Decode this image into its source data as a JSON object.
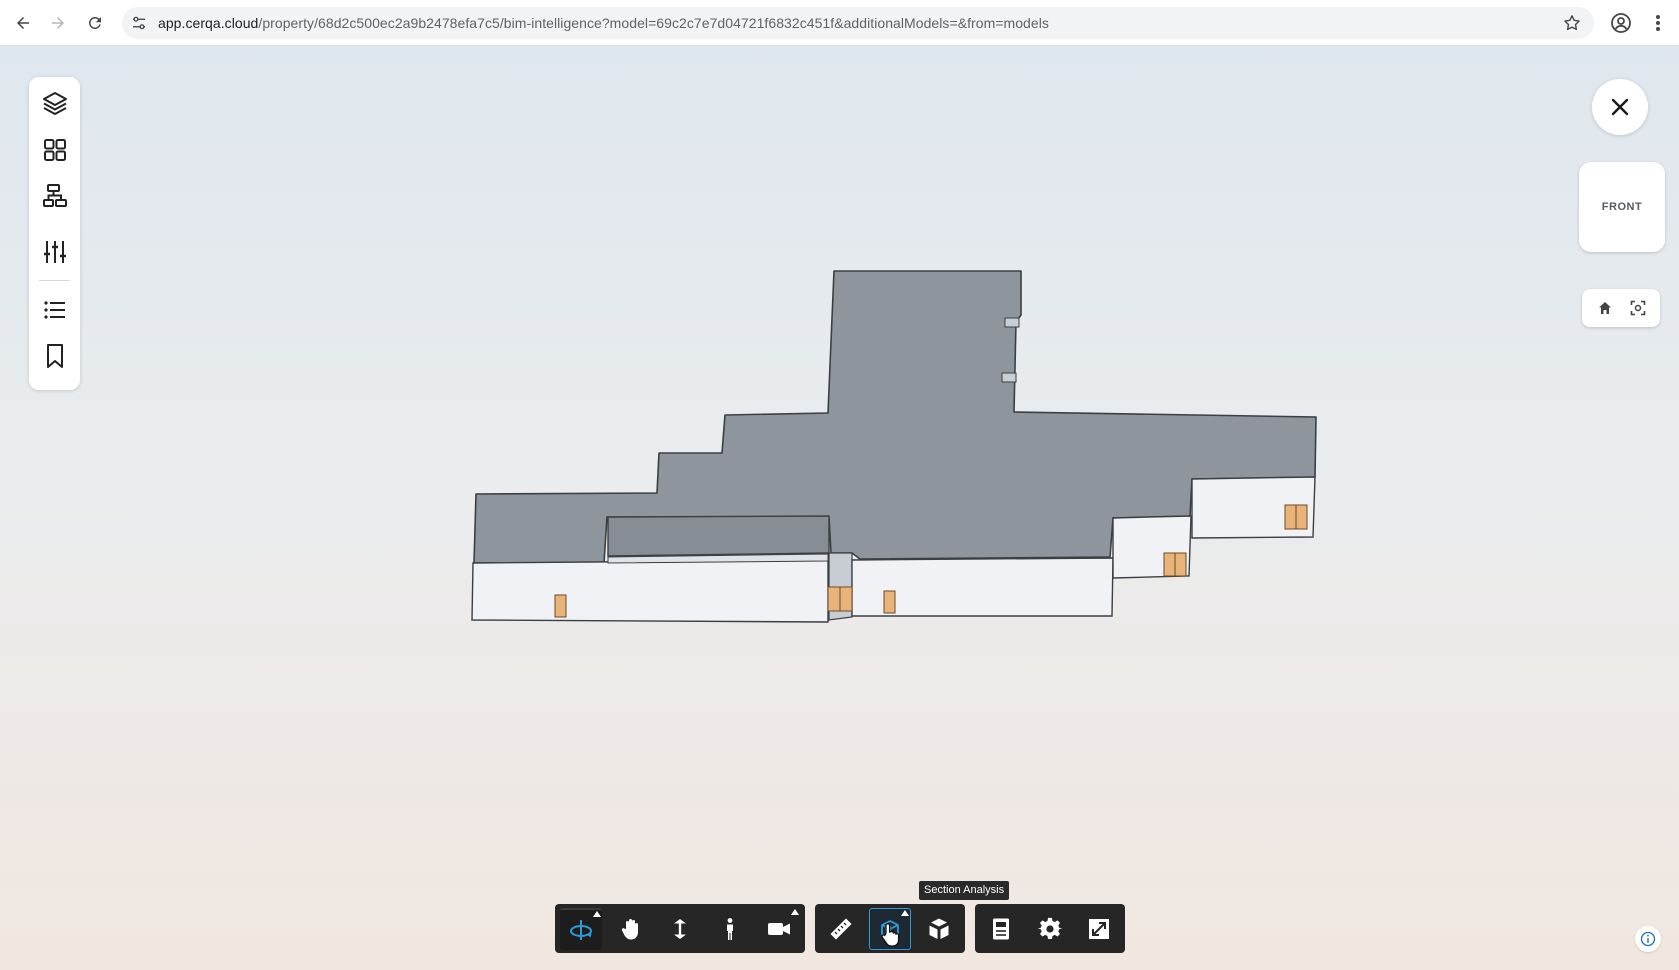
{
  "browser": {
    "url_host": "app.cerqa.cloud",
    "url_path": "/property/68d2c500ec2a9b2478efa7c5/bim-intelligence?model=69c2c7e7d04721f6832c451f&additionalModels=&from=models",
    "icons": [
      "back-arrow-icon",
      "forward-arrow-icon",
      "reload-icon",
      "site-settings-icon",
      "bookmark-star-icon",
      "account-icon",
      "more-vert-icon"
    ]
  },
  "left_toolbar": {
    "items": [
      "layers-icon",
      "grid-icon",
      "hierarchy-icon",
      "sliders-icon",
      "list-icon",
      "bookmark-icon"
    ]
  },
  "view_cube": {
    "face_label": "FRONT"
  },
  "nav_pill": {
    "items": [
      "home-icon",
      "fit-view-icon"
    ]
  },
  "bottom_toolbar": {
    "groups": [
      {
        "items": [
          "orbit-icon",
          "pan-hand-icon",
          "zoom-icon",
          "walk-person-icon",
          "camera-icon"
        ]
      },
      {
        "items": [
          "measure-ruler-icon",
          "section-analysis-icon",
          "explode-model-icon"
        ]
      },
      {
        "items": [
          "properties-icon",
          "settings-gear-icon",
          "fullscreen-icon"
        ]
      }
    ],
    "active_tool": "section-analysis-icon",
    "tooltip": "Section Analysis"
  },
  "colors": {
    "accent": "#2e9bd6",
    "toolbar_bg": "#262626",
    "model_top": "#8e959d",
    "model_wall": "#f0f2f5",
    "door": "#e8b47a"
  }
}
